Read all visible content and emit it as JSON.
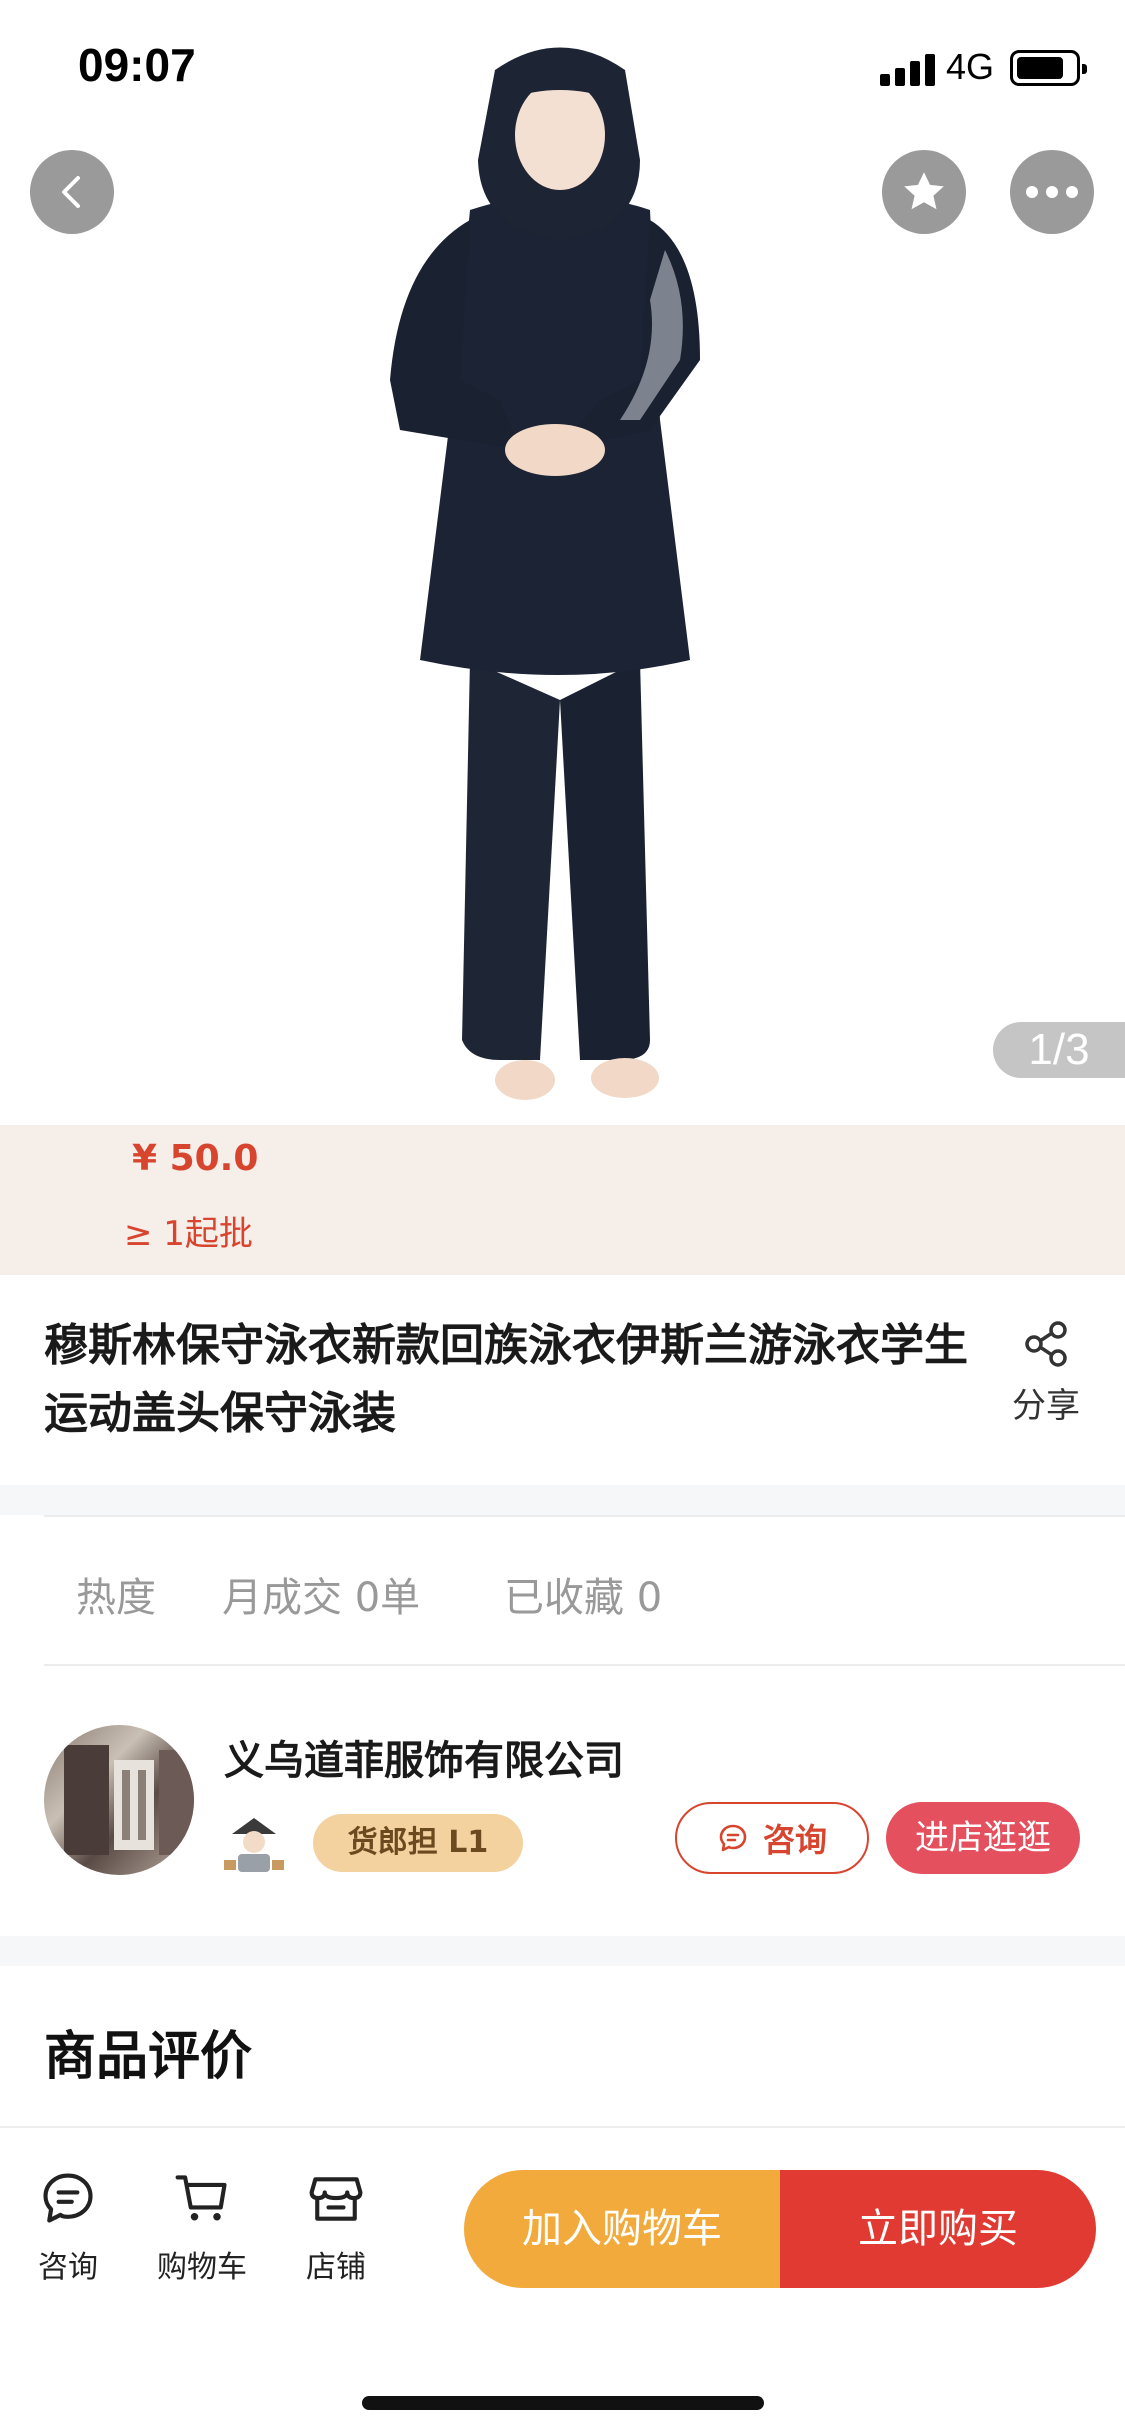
{
  "status_bar": {
    "time": "09:07",
    "network": "4G",
    "battery_level": 0.8
  },
  "gallery": {
    "counter": "1/3",
    "current": 1,
    "total": 3
  },
  "price": {
    "amount": "¥ 50.0",
    "min_order": "≥ 1起批"
  },
  "product": {
    "title": "穆斯林保守泳衣新款回族泳衣伊斯兰游泳衣学生运动盖头保守泳装",
    "share_label": "分享"
  },
  "stats": {
    "heat_label": "热度",
    "monthly_sales": "月成交 0单",
    "favorites": "已收藏 0"
  },
  "shop": {
    "name": "义乌道菲服饰有限公司",
    "level_badge": "货郎担 L1",
    "consult_label": "咨询",
    "enter_label": "进店逛逛"
  },
  "reviews": {
    "section_title": "商品评价"
  },
  "bottom_bar": {
    "tabs": [
      {
        "label": "咨询",
        "icon": "chat-icon"
      },
      {
        "label": "购物车",
        "icon": "cart-icon"
      },
      {
        "label": "店铺",
        "icon": "store-icon"
      }
    ],
    "add_to_cart": "加入购物车",
    "buy_now": "立即购买"
  },
  "colors": {
    "price_red": "#d8452f",
    "add_to_cart_orange": "#f1aa3b",
    "buy_now_red": "#e03a33",
    "enter_shop_pink": "#e4505e",
    "badge_gold": "#f3d2a0",
    "price_band_bg": "#f5eee9"
  }
}
